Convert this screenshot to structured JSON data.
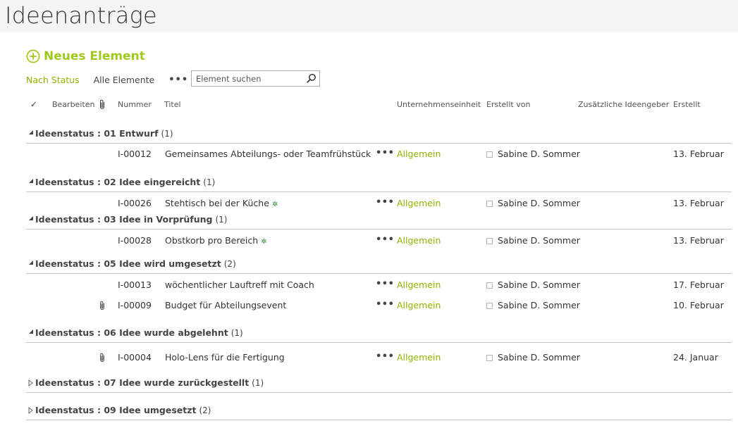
{
  "page": {
    "title": "Ideenanträge"
  },
  "toolbar": {
    "new_item_label": "Neues Element",
    "views": [
      "Nach Status",
      "Alle Elemente"
    ],
    "more": "•••",
    "search_placeholder": "Element suchen"
  },
  "columns": {
    "check": "✓",
    "edit": "Bearbeiten",
    "number": "Nummer",
    "title": "Titel",
    "unit": "Unternehmenseinheit",
    "created_by": "Erstellt von",
    "additional": "Zusätzliche Ideengeber",
    "created": "Erstellt"
  },
  "groups": [
    {
      "label": "Ideenstatus : 01 Entwurf",
      "count": "(1)",
      "expanded": true,
      "items": [
        {
          "number": "I-00012",
          "title": "Gemeinsames Abteilungs- oder Teamfrühstück",
          "unit": "Allgemein",
          "created_by": "Sabine D. Sommer",
          "created": "13. Februar",
          "attachment": false,
          "new": false
        }
      ]
    },
    {
      "label": "Ideenstatus : 02 Idee eingereicht",
      "count": "(1)",
      "expanded": true,
      "items": [
        {
          "number": "I-00026",
          "title": "Stehtisch bei der Küche",
          "unit": "Allgemein",
          "created_by": "Sabine D. Sommer",
          "created": "13. Februar",
          "attachment": false,
          "new": true
        }
      ]
    },
    {
      "label": "Ideenstatus : 03 Idee in Vorprüfung",
      "count": "(1)",
      "expanded": true,
      "items": [
        {
          "number": "I-00028",
          "title": "Obstkorb pro Bereich",
          "unit": "Allgemein",
          "created_by": "Sabine D. Sommer",
          "created": "13. Februar",
          "attachment": false,
          "new": true
        }
      ]
    },
    {
      "label": "Ideenstatus : 05 Idee wird umgesetzt",
      "count": "(2)",
      "expanded": true,
      "items": [
        {
          "number": "I-00013",
          "title": "wöchentlicher Lauftreff mit Coach",
          "unit": "Allgemein",
          "created_by": "Sabine D. Sommer",
          "created": "17. Februar",
          "attachment": false,
          "new": false
        },
        {
          "number": "I-00009",
          "title": "Budget für Abteilungsevent",
          "unit": "Allgemein",
          "created_by": "Sabine D. Sommer",
          "created": "10. Februar",
          "attachment": true,
          "new": false
        }
      ]
    },
    {
      "label": "Ideenstatus : 06 Idee wurde abgelehnt",
      "count": "(1)",
      "expanded": true,
      "items": [
        {
          "number": "I-00004",
          "title": "Holo-Lens für die Fertigung",
          "unit": "Allgemein",
          "created_by": "Sabine D. Sommer",
          "created": "24. Januar",
          "attachment": true,
          "new": false
        }
      ]
    },
    {
      "label": "Ideenstatus : 07 Idee wurde zurückgestellt",
      "count": "(1)",
      "expanded": false,
      "items": []
    },
    {
      "label": "Ideenstatus : 09 Idee umgesetzt",
      "count": "(2)",
      "expanded": false,
      "items": []
    }
  ],
  "row_more": "•••",
  "new_marker": "✲",
  "colors": {
    "accent": "#8cb400",
    "new_marker": "#2e8b2e"
  }
}
